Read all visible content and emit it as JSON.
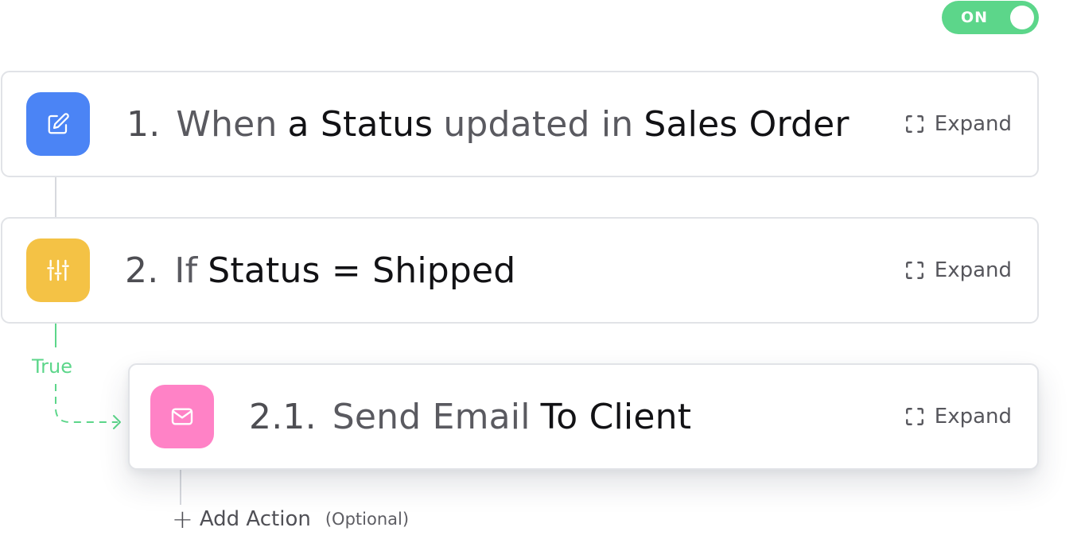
{
  "toggle": {
    "label": "ON",
    "state": "on",
    "color": "#5cd68a"
  },
  "steps": [
    {
      "number": "1.",
      "icon": "edit-icon",
      "color": "#4b84f5",
      "title": {
        "p1": "When",
        "p2": "a Status",
        "p3": "updated in",
        "p4": "Sales Order"
      },
      "expand_label": "Expand"
    },
    {
      "number": "2.",
      "icon": "sliders-icon",
      "color": "#f4c245",
      "title": {
        "p1": "If",
        "p2": "Status = Shipped"
      },
      "expand_label": "Expand"
    },
    {
      "number": "2.1.",
      "icon": "mail-icon",
      "color": "#ff82c6",
      "title": {
        "p1": "Send Email",
        "p2": "To Client"
      },
      "expand_label": "Expand"
    }
  ],
  "branch_label": "True",
  "add_action": {
    "label": "Add Action",
    "optional": "(Optional)"
  }
}
